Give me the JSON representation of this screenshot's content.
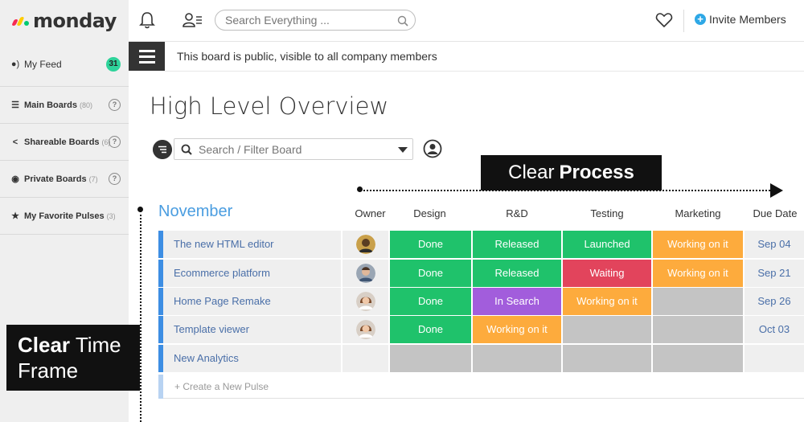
{
  "header": {
    "logo_text": "monday",
    "search_placeholder": "Search Everything ...",
    "invite_label": "Invite Members"
  },
  "sidebar": {
    "items": [
      {
        "icon": "feed-icon",
        "label": "My Feed",
        "count": "",
        "badge": "31"
      },
      {
        "icon": "list-icon",
        "label": "Main Boards",
        "count": "(80)"
      },
      {
        "icon": "share-icon",
        "label": "Shareable Boards",
        "count": "(6)"
      },
      {
        "icon": "lock-icon",
        "label": "Private Boards",
        "count": "(7)"
      },
      {
        "icon": "star-icon",
        "label": "My Favorite Pulses",
        "count": "(3)"
      }
    ]
  },
  "board": {
    "notice": "This board is public, visible to all company members",
    "title": "High Level Overview",
    "filter_placeholder": "Search / Filter Board",
    "group_name": "November",
    "columns": [
      "Owner",
      "Design",
      "R&D",
      "Testing",
      "Marketing",
      "Due Date"
    ],
    "rows": [
      {
        "name": "The new HTML editor",
        "design": "Done",
        "rnd": "Released",
        "testing": "Launched",
        "marketing": "Working on it",
        "due": "Sep 04"
      },
      {
        "name": "Ecommerce platform",
        "design": "Done",
        "rnd": "Released",
        "testing": "Waiting",
        "marketing": "Working on it",
        "due": "Sep 21"
      },
      {
        "name": "Home Page Remake",
        "design": "Done",
        "rnd": "In Search",
        "testing": "Working on it",
        "marketing": "",
        "due": "Sep 26"
      },
      {
        "name": "Template viewer",
        "design": "Done",
        "rnd": "Working on it",
        "testing": "",
        "marketing": "",
        "due": "Oct 03"
      },
      {
        "name": "New Analytics",
        "design": "",
        "rnd": "",
        "testing": "",
        "marketing": "",
        "due": ""
      }
    ],
    "new_pulse": "+ Create a New Pulse"
  },
  "callouts": {
    "process_light": "Clear",
    "process_bold": "Process",
    "time_bold": "Clear",
    "time_rest": "Time",
    "time_line2": "Frame"
  },
  "colors": {
    "done": "#1fc26b",
    "released": "#1fc26b",
    "launched": "#1fc26b",
    "waiting": "#e2445c",
    "working": "#fdab3d",
    "in_search": "#a25ddc",
    "empty": "#c4c4c4",
    "group": "#4a9de0",
    "row_bar": "#3d8ee3"
  }
}
